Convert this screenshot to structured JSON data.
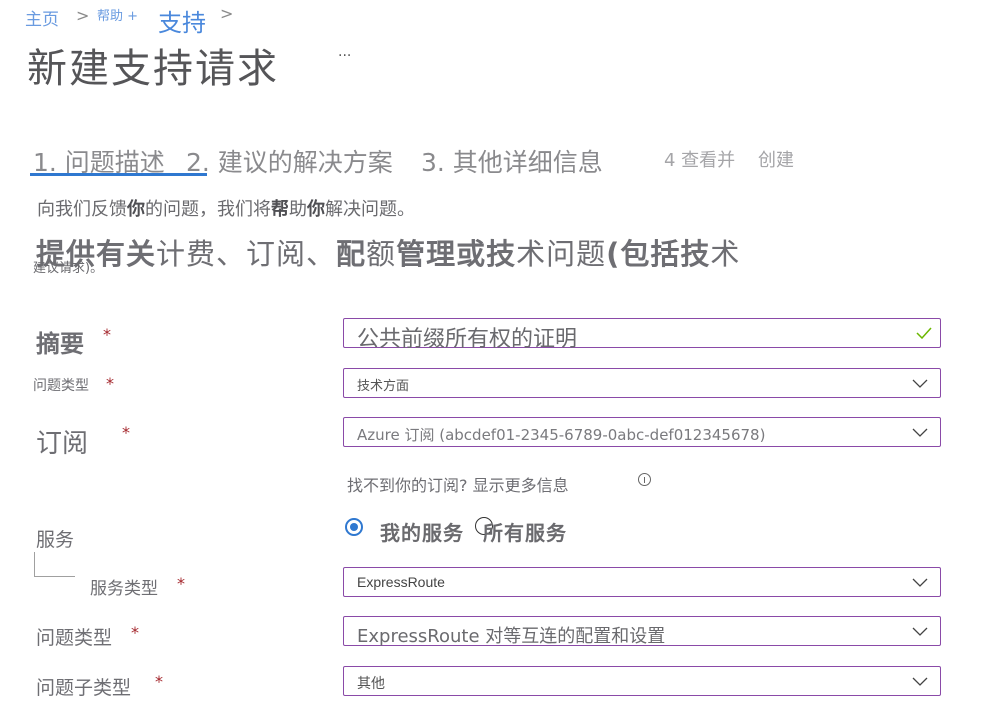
{
  "breadcrumb": {
    "home": "主页",
    "sep1": ">",
    "help": "帮助 +",
    "support": "支持",
    "sep2": ">"
  },
  "page": {
    "title": "新建支持请求",
    "more": "..."
  },
  "steps": [
    {
      "label": "1. 问题描述",
      "active": true
    },
    {
      "label": "2. 建议的解决方案",
      "active": false
    },
    {
      "label": "3. 其他详细信息",
      "active": false
    },
    {
      "label": "4 查看并",
      "active": false
    },
    {
      "label": "创建",
      "active": false
    }
  ],
  "intro": {
    "line1_parts": [
      "向我们反馈",
      "你",
      "的问题，我们将",
      "帮",
      "助",
      "你",
      "解决问题。"
    ],
    "line2_bold1": "提供有关",
    "line2_light1": "计费、订阅、",
    "line2_bold2": "配",
    "line2_light2": "额",
    "line2_bold3": "管理或技",
    "line2_light3": "术问题",
    "line2_bold4": "(包括技",
    "line2_light4": "术",
    "line3": "建议请求)。"
  },
  "form": {
    "summary": {
      "label": "摘要",
      "required": "*",
      "value": "公共前缀所有权的证明",
      "valid_icon": "checkmark-icon"
    },
    "issue_type": {
      "label": "问题类型",
      "required": "*",
      "value": "技术方面"
    },
    "subscription": {
      "label": "订阅",
      "required": "*",
      "value": "Azure 订阅 (abcdef01-2345-6789-0abc-def012345678)"
    },
    "subscription_help": "找不到你的订阅? 显示更多信息",
    "service": {
      "label": "服务",
      "options": [
        {
          "label": "我的服务",
          "selected": true
        },
        {
          "label": "所有服务",
          "selected": false
        }
      ]
    },
    "service_type": {
      "label": "服务类型",
      "required": "*",
      "value": "ExpressRoute"
    },
    "problem_type": {
      "label": "问题类型",
      "required": "*",
      "value": "ExpressRoute 对等互连的配置和设置"
    },
    "problem_subtype": {
      "label": "问题子类型",
      "required": "*",
      "value": "其他"
    }
  },
  "colors": {
    "accent": "#2f78d0",
    "field_border": "#8a4aa8",
    "required": "#a4262c",
    "valid": "#6bb700",
    "breadcrumb": "#6a9be0"
  }
}
